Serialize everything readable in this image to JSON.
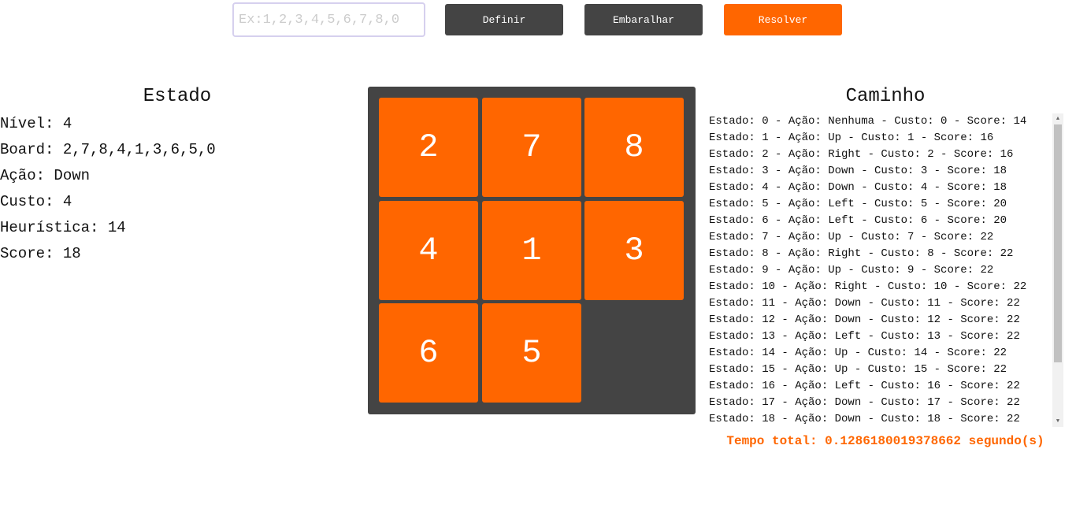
{
  "toolbar": {
    "input_placeholder": "Ex:1,2,3,4,5,6,7,8,0",
    "input_value": "",
    "definir_label": "Definir",
    "embaralhar_label": "Embaralhar",
    "resolver_label": "Resolver"
  },
  "estado": {
    "title": "Estado",
    "lines": [
      "Nível: 4",
      "Board: 2,7,8,4,1,3,6,5,0",
      "Ação: Down",
      "Custo: 4",
      "Heurística: 14",
      "Score: 18"
    ]
  },
  "board": {
    "tiles": [
      "2",
      "7",
      "8",
      "4",
      "1",
      "3",
      "6",
      "5",
      ""
    ]
  },
  "caminho": {
    "title": "Caminho",
    "items": [
      "Estado: 0 - Ação: Nenhuma - Custo: 0 - Score: 14",
      "Estado: 1 - Ação: Up - Custo: 1 - Score: 16",
      "Estado: 2 - Ação: Right - Custo: 2 - Score: 16",
      "Estado: 3 - Ação: Down - Custo: 3 - Score: 18",
      "Estado: 4 - Ação: Down - Custo: 4 - Score: 18",
      "Estado: 5 - Ação: Left - Custo: 5 - Score: 20",
      "Estado: 6 - Ação: Left - Custo: 6 - Score: 20",
      "Estado: 7 - Ação: Up - Custo: 7 - Score: 22",
      "Estado: 8 - Ação: Right - Custo: 8 - Score: 22",
      "Estado: 9 - Ação: Up - Custo: 9 - Score: 22",
      "Estado: 10 - Ação: Right - Custo: 10 - Score: 22",
      "Estado: 11 - Ação: Down - Custo: 11 - Score: 22",
      "Estado: 12 - Ação: Down - Custo: 12 - Score: 22",
      "Estado: 13 - Ação: Left - Custo: 13 - Score: 22",
      "Estado: 14 - Ação: Up - Custo: 14 - Score: 22",
      "Estado: 15 - Ação: Up - Custo: 15 - Score: 22",
      "Estado: 16 - Ação: Left - Custo: 16 - Score: 22",
      "Estado: 17 - Ação: Down - Custo: 17 - Score: 22",
      "Estado: 18 - Ação: Down - Custo: 18 - Score: 22"
    ],
    "tempo_total": "Tempo total: 0.1286180019378662 segundo(s)"
  },
  "colors": {
    "accent": "#ff6600",
    "dark": "#444444"
  },
  "icons": {
    "scroll_up": "scroll-up-arrow-icon",
    "scroll_down": "scroll-down-arrow-icon"
  }
}
